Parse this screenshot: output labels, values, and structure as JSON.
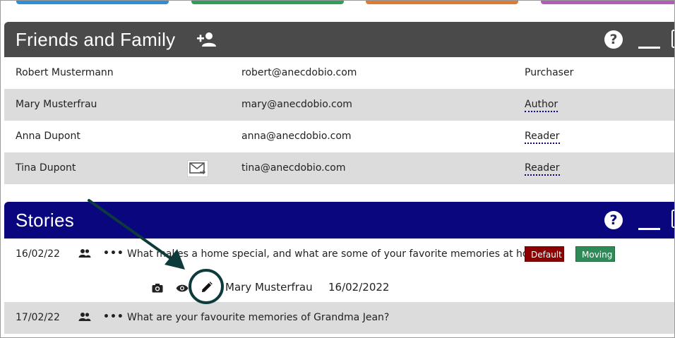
{
  "colors": {
    "strip_blue": "#2f8fd6",
    "strip_green": "#2e9e59",
    "strip_orange": "#e07a2f",
    "strip_purple": "#b45ab8",
    "friends_header": "#4a4a4a",
    "stories_header": "#0a067d",
    "tag_default": "#8b0000",
    "tag_moving": "#2e8b57",
    "annotation": "#0d3b3b"
  },
  "friends": {
    "title": "Friends and Family",
    "icons": {
      "add": "person-add-icon",
      "help": "help-icon",
      "minimize": "minimize-icon"
    },
    "help_label": "?",
    "rows": [
      {
        "name": "Robert Mustermann",
        "email": "robert@anecdobio.com",
        "role": "Purchaser"
      },
      {
        "name": "Mary Musterfrau",
        "email": "mary@anecdobio.com",
        "role": "Author"
      },
      {
        "name": "Anna Dupont",
        "email": "anna@anecdobio.com",
        "role": "Reader"
      },
      {
        "name": "Tina Dupont",
        "email": "tina@anecdobio.com",
        "role": "Reader"
      }
    ]
  },
  "stories": {
    "title": "Stories",
    "help_label": "?",
    "dots_label": "•••",
    "items": [
      {
        "date": "16/02/22",
        "question": "What makes a home special, and what are some of your favorite memories at home?",
        "tags": [
          "Default",
          "Moving"
        ],
        "author": "Mary Musterfrau",
        "author_date": "16/02/2022"
      },
      {
        "date": "17/02/22",
        "question": "What are your favourite memories of Grandma Jean?"
      }
    ]
  }
}
